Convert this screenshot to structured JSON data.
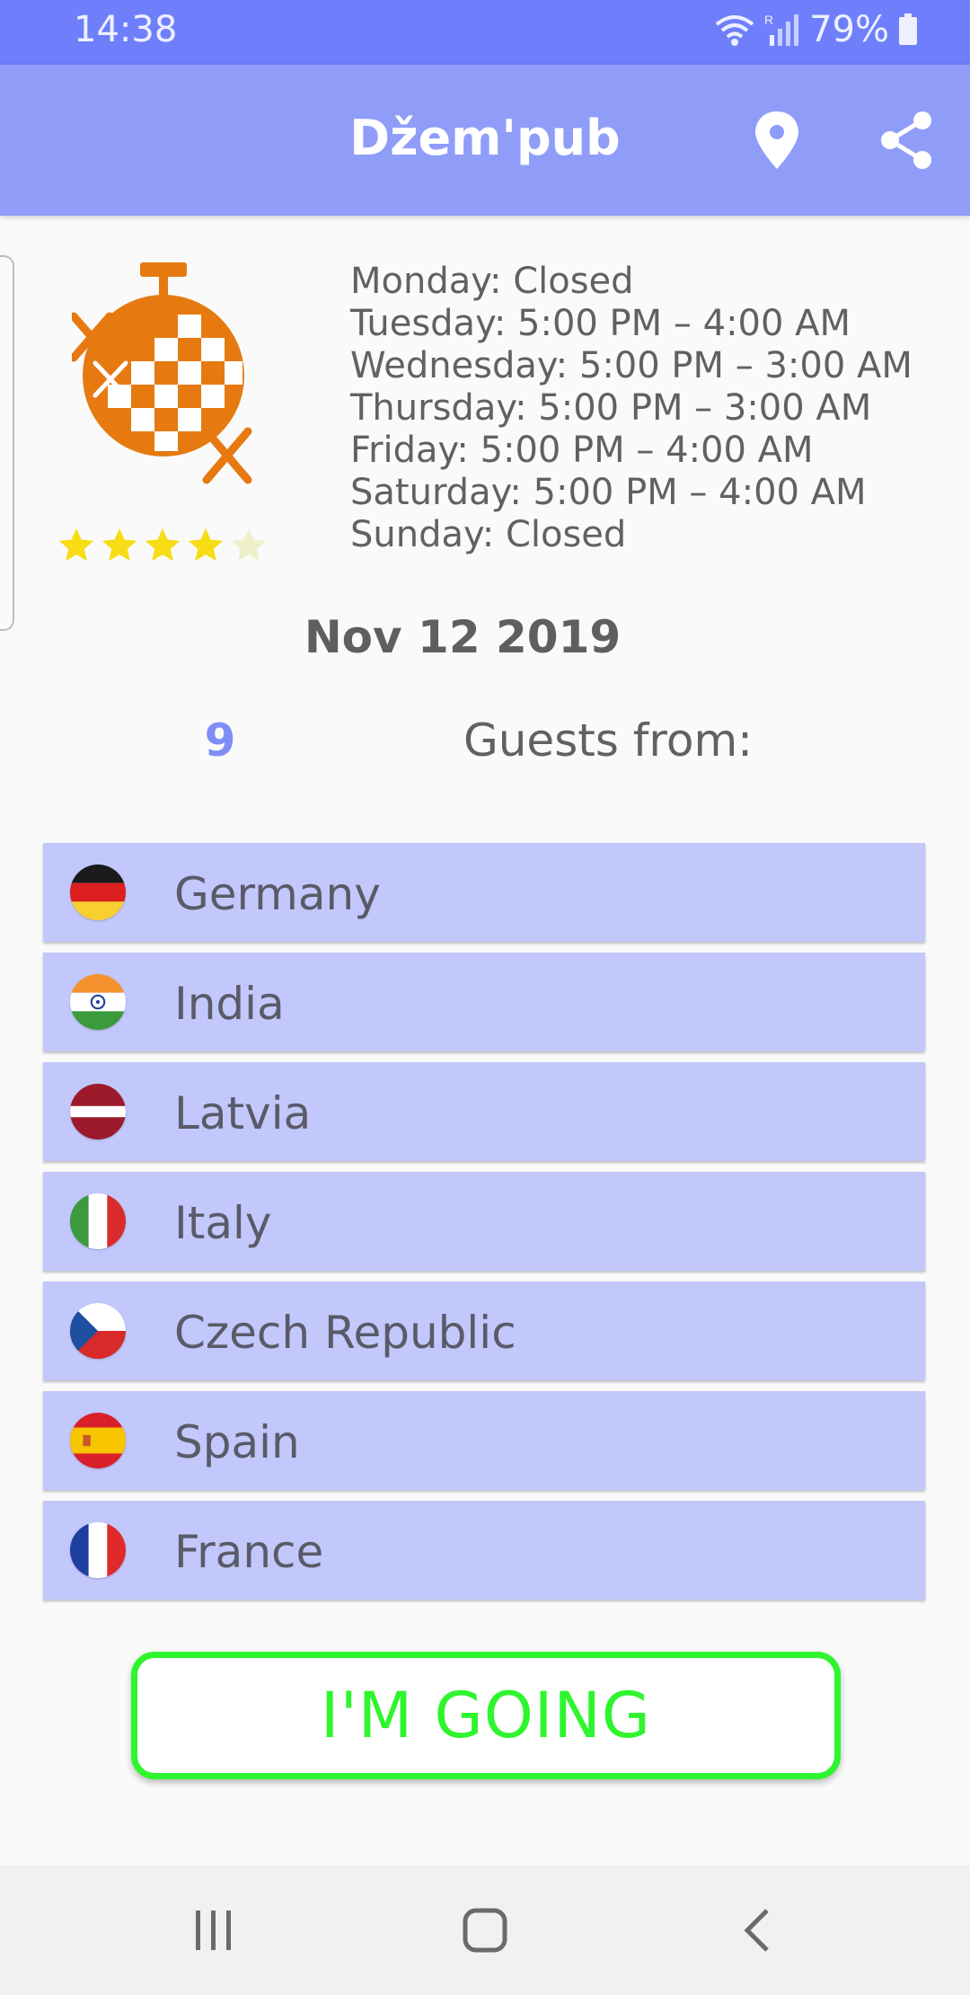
{
  "status_bar": {
    "time": "14:38",
    "battery": "79%",
    "icons": [
      "wifi-icon",
      "signal-icon",
      "battery-icon"
    ]
  },
  "app_bar": {
    "title": "Džem'pub",
    "icons": [
      "location-pin-icon",
      "share-icon"
    ]
  },
  "venue": {
    "logo_icon": "disco-ball-logo",
    "rating": 4,
    "rating_max": 5,
    "hours": [
      "Monday: Closed",
      "Tuesday: 5:00 PM – 4:00 AM",
      "Wednesday: 5:00 PM – 3:00 AM",
      "Thursday: 5:00 PM – 3:00 AM",
      "Friday: 5:00 PM – 4:00 AM",
      "Saturday: 5:00 PM – 4:00 AM",
      "Sunday: Closed"
    ]
  },
  "event": {
    "date": "Nov 12 2019",
    "guest_count": "9",
    "guests_label": "Guests from:"
  },
  "countries": [
    {
      "name": "Germany",
      "flag": "germany-flag-icon"
    },
    {
      "name": "India",
      "flag": "india-flag-icon"
    },
    {
      "name": "Latvia",
      "flag": "latvia-flag-icon"
    },
    {
      "name": "Italy",
      "flag": "italy-flag-icon"
    },
    {
      "name": "Czech Republic",
      "flag": "czech-flag-icon"
    },
    {
      "name": "Spain",
      "flag": "spain-flag-icon"
    },
    {
      "name": "France",
      "flag": "france-flag-icon"
    }
  ],
  "actions": {
    "going_label": "I'M GOING"
  },
  "nav_bar": {
    "icons": [
      "recent-apps-icon",
      "home-icon",
      "back-icon"
    ]
  },
  "colors": {
    "status_bar": "#6f7ffc",
    "app_bar": "#8f9df9",
    "list_item": "#c2c8fc",
    "accent_green": "#2ef52e",
    "count_blue": "#7f8df7",
    "logo_orange": "#e67a10",
    "star_filled": "#f7dc16",
    "star_empty": "#eef0c9"
  }
}
